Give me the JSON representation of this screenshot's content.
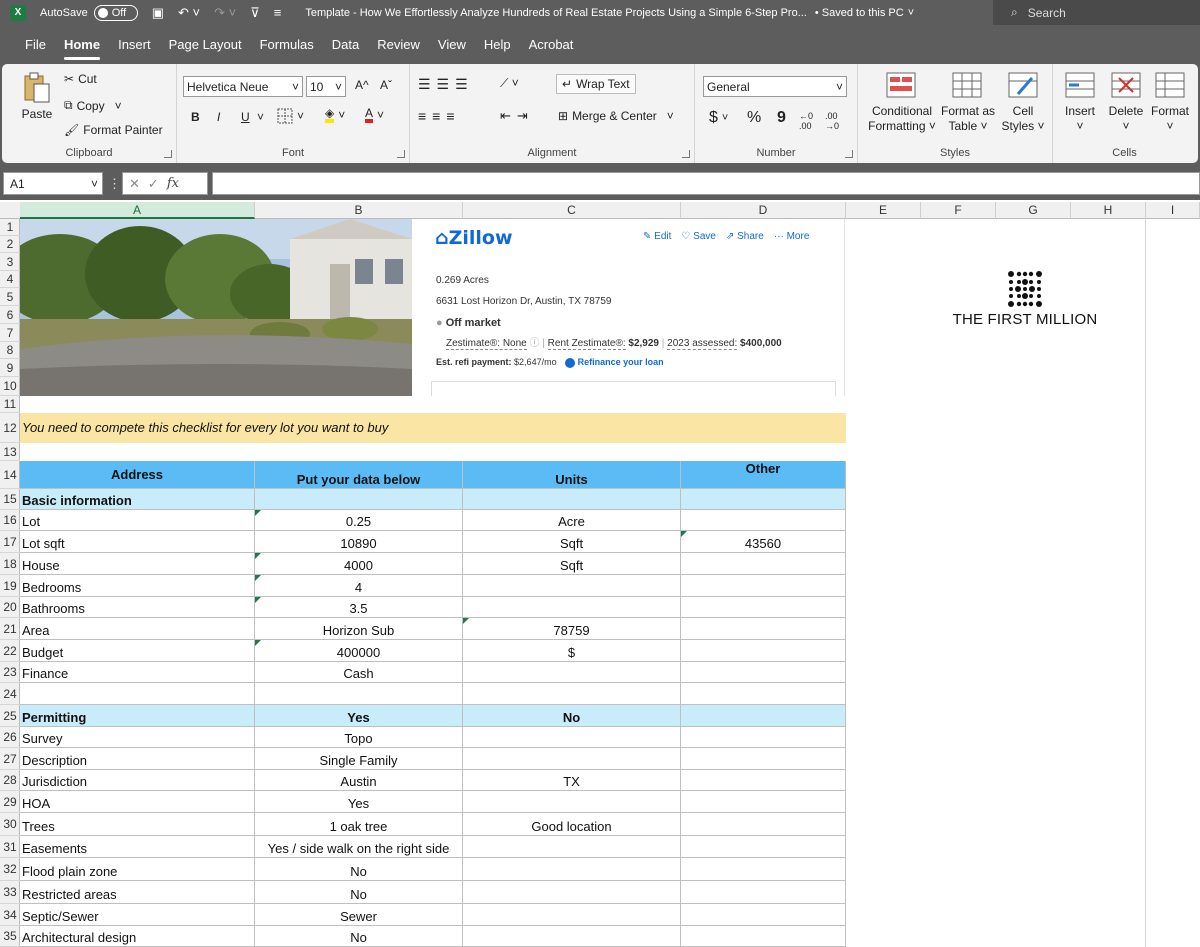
{
  "titlebar": {
    "app_icon": "X",
    "autosave_label": "AutoSave",
    "autosave_state": "Off",
    "doc_title": "Template - How We Effortlessly Analyze Hundreds of Real Estate Projects Using a Simple 6-Step Pro...",
    "saved_status": "• Saved to this PC",
    "search_placeholder": "Search"
  },
  "menu": [
    "File",
    "Home",
    "Insert",
    "Page Layout",
    "Formulas",
    "Data",
    "Review",
    "View",
    "Help",
    "Acrobat"
  ],
  "ribbon": {
    "clipboard": {
      "paste": "Paste",
      "cut": "Cut",
      "copy": "Copy",
      "format_painter": "Format Painter",
      "label": "Clipboard"
    },
    "font": {
      "family": "Helvetica Neue",
      "size": "10",
      "bold": "B",
      "italic": "I",
      "underline": "U",
      "grow": "A^",
      "shrink": "Aˇ",
      "font_color": "A",
      "label": "Font"
    },
    "alignment": {
      "wrap_text": "Wrap Text",
      "merge_center": "Merge & Center",
      "label": "Alignment"
    },
    "number": {
      "format": "General",
      "currency": "$",
      "percent": "%",
      "comma": "9",
      "label": "Number"
    },
    "styles": {
      "conditional_1": "Conditional",
      "conditional_2": "Formatting",
      "format_table_1": "Format as",
      "format_table_2": "Table",
      "cell_styles_1": "Cell",
      "cell_styles_2": "Styles",
      "label": "Styles"
    },
    "cells": {
      "insert": "Insert",
      "delete": "Delete",
      "format": "Format",
      "label": "Cells"
    }
  },
  "formula_bar": {
    "name_box": "A1",
    "fx": "fx",
    "value": ""
  },
  "columns": [
    "A",
    "B",
    "C",
    "D",
    "E",
    "F",
    "G",
    "H",
    "I"
  ],
  "rows": [
    "1",
    "2",
    "3",
    "4",
    "5",
    "6",
    "7",
    "8",
    "9",
    "10",
    "11",
    "12",
    "13",
    "14",
    "15",
    "16",
    "17",
    "18",
    "19",
    "20",
    "21",
    "22",
    "23",
    "24",
    "25",
    "26",
    "27",
    "28",
    "29",
    "30",
    "31",
    "32",
    "33",
    "34",
    "35"
  ],
  "zillow": {
    "logo": "Zillow",
    "edit": "Edit",
    "save": "Save",
    "share": "Share",
    "more": "More",
    "acres": "0.269 Acres",
    "address": "6631 Lost Horizon Dr, Austin, TX 78759",
    "status": "Off market",
    "zestimate": "Zestimate®: None",
    "rent_label": "Rent Zestimate®:",
    "rent_value": "$2,929",
    "assessed_label": "2023 assessed:",
    "assessed_value": "$400,000",
    "refi_label": "Est. refi payment:",
    "refi_value": "$2,647/mo",
    "refi_link": "Refinance your loan"
  },
  "brand": {
    "name": "THE FIRST MILLION"
  },
  "notice": "You need to compete this checklist for every lot you want to buy",
  "table": {
    "headers": {
      "address": "Address",
      "data": "Put your data below",
      "units": "Units",
      "other": "Other"
    },
    "section_basic": "Basic information",
    "basic_rows": [
      {
        "label": "Lot",
        "data": "0.25",
        "units": "Acre",
        "other": ""
      },
      {
        "label": "Lot sqft",
        "data": "10890",
        "units": "Sqft",
        "other": "43560"
      },
      {
        "label": "House",
        "data": "4000",
        "units": "Sqft",
        "other": ""
      },
      {
        "label": "Bedrooms",
        "data": "4",
        "units": "",
        "other": ""
      },
      {
        "label": "Bathrooms",
        "data": "3.5",
        "units": "",
        "other": ""
      },
      {
        "label": "Area",
        "data": "Horizon Sub",
        "units": "78759",
        "other": ""
      },
      {
        "label": "Budget",
        "data": "400000",
        "units": "$",
        "other": ""
      },
      {
        "label": "Finance",
        "data": "Cash",
        "units": "",
        "other": ""
      }
    ],
    "section_permitting": "Permitting",
    "permit_yes": "Yes",
    "permit_no": "No",
    "permit_rows": [
      {
        "label": "Survey",
        "yes": "Topo",
        "no": ""
      },
      {
        "label": "Description",
        "yes": "Single Family",
        "no": ""
      },
      {
        "label": "Jurisdiction",
        "yes": "Austin",
        "no": "TX"
      },
      {
        "label": "HOA",
        "yes": "Yes",
        "no": ""
      },
      {
        "label": "Trees",
        "yes": "1 oak tree",
        "no": "Good location"
      },
      {
        "label": "Easements",
        "yes": "Yes / side walk on the right side",
        "no": ""
      },
      {
        "label": "Flood plain zone",
        "yes": "No",
        "no": ""
      },
      {
        "label": "Restricted areas",
        "yes": "No",
        "no": ""
      },
      {
        "label": "Septic/Sewer",
        "yes": "Sewer",
        "no": ""
      },
      {
        "label": "Architectural design",
        "yes": "No",
        "no": ""
      }
    ]
  },
  "colors": {
    "header_blue": "#5bbcf5",
    "section_blue": "#c9ecfb",
    "notice_yellow": "#fbe5a5",
    "excel_green": "#217346"
  }
}
